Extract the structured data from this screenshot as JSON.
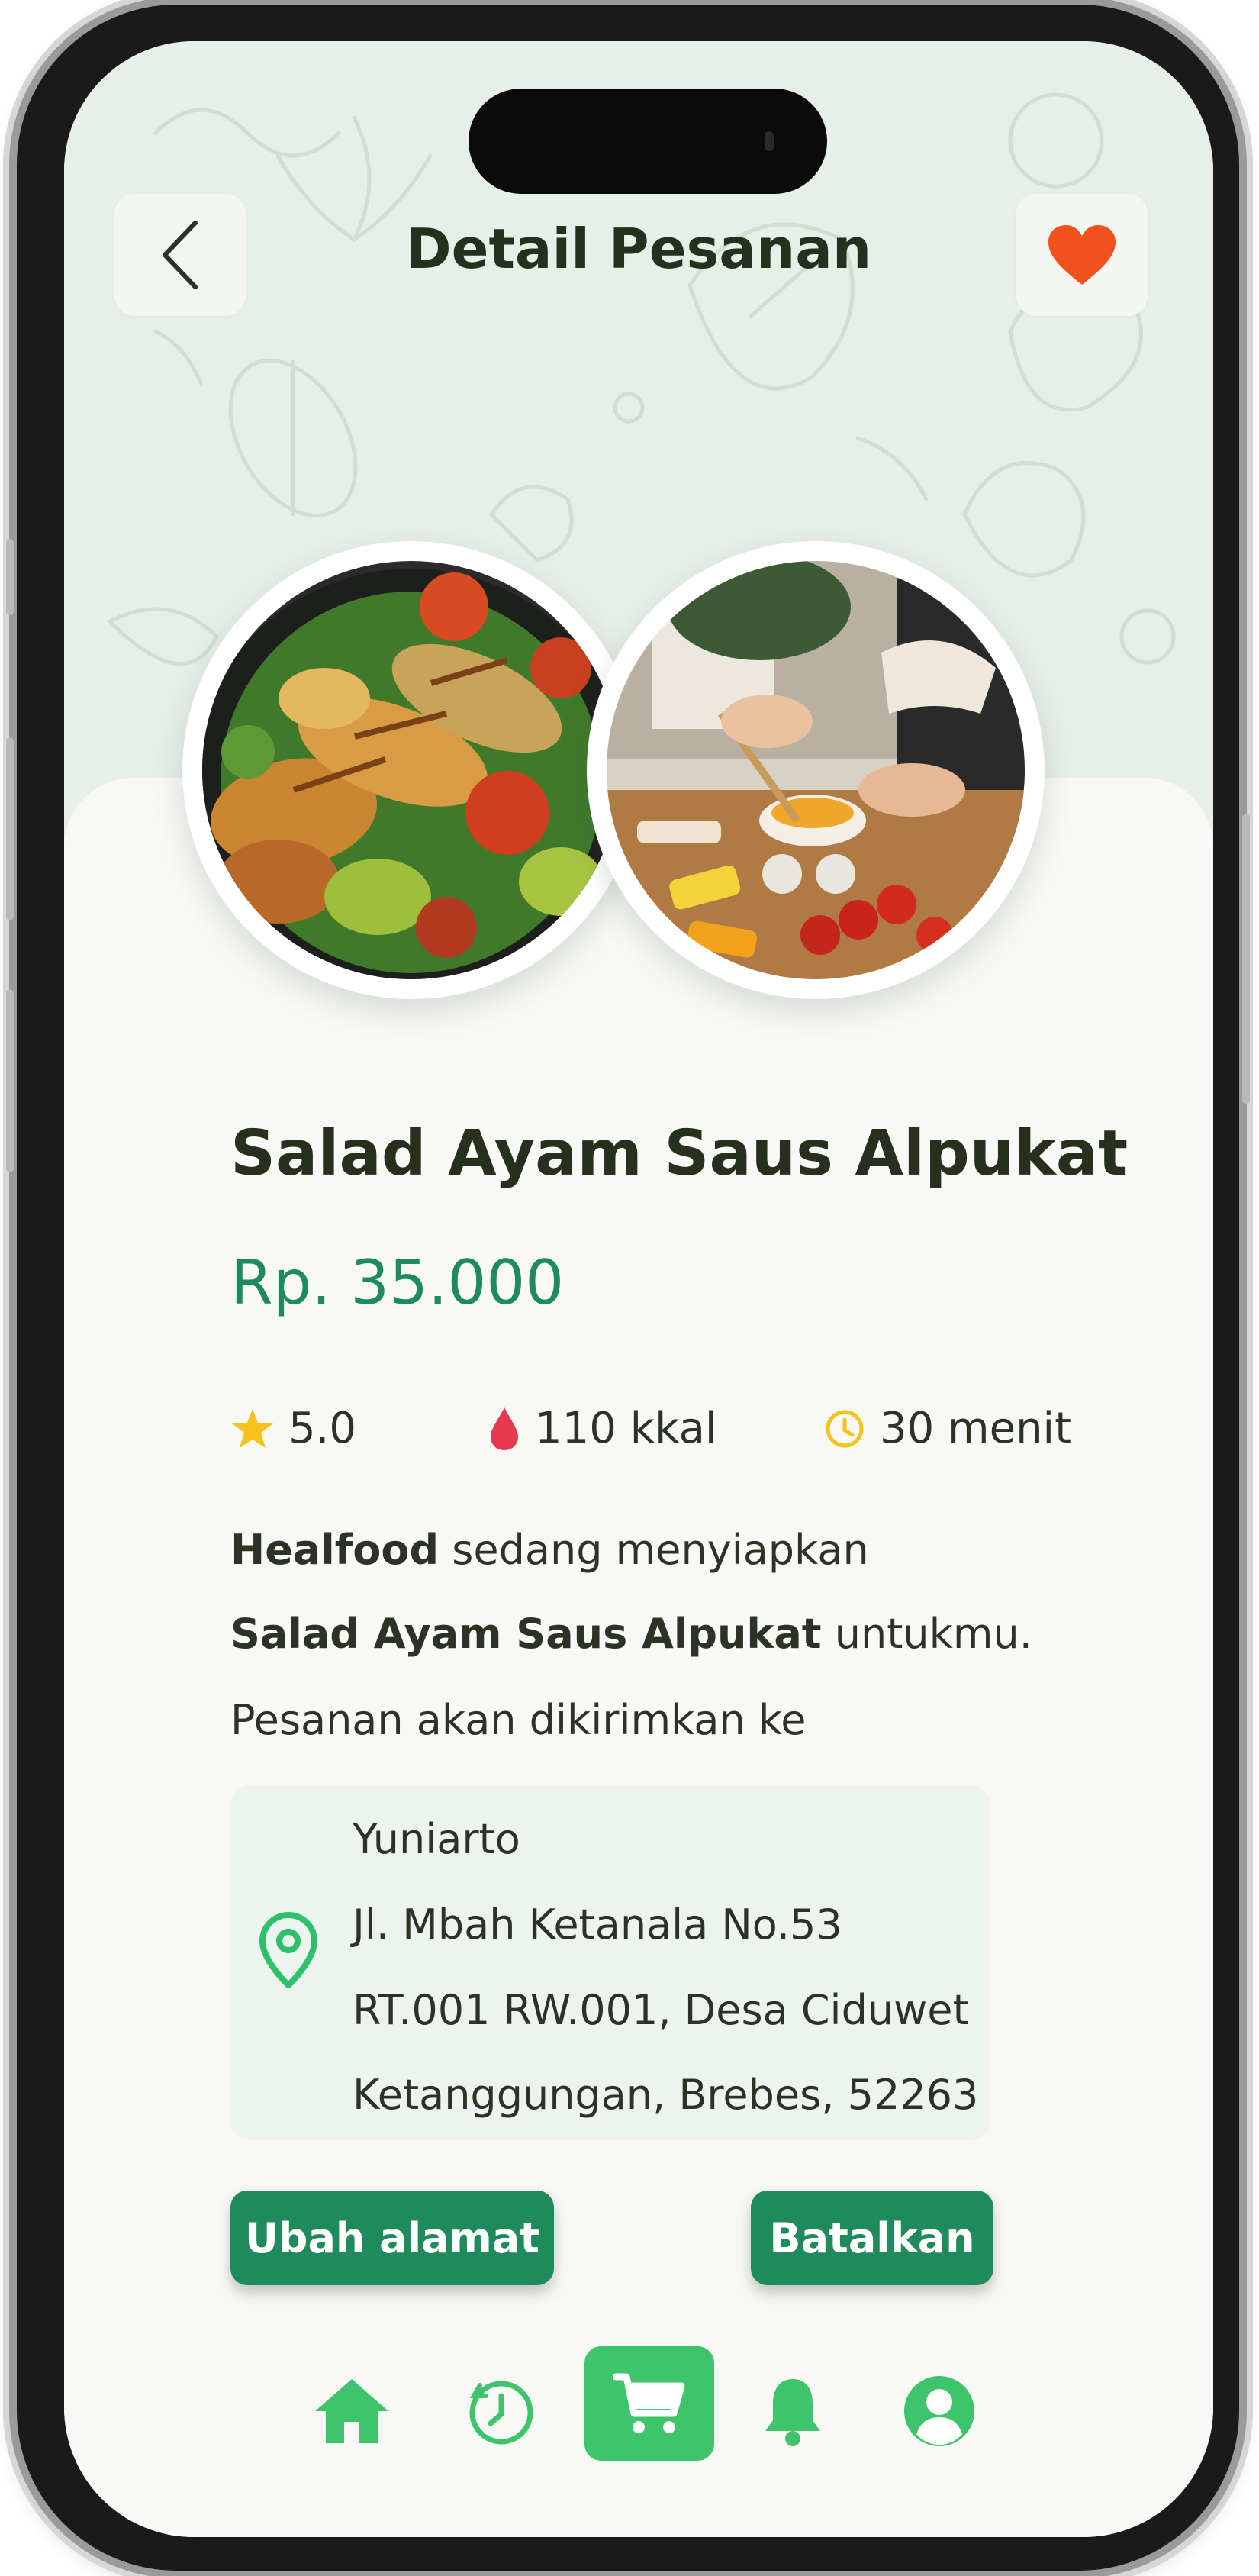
{
  "header": {
    "title": "Detail Pesanan",
    "back_icon": "chevron-left-icon",
    "favorite_icon": "heart-icon"
  },
  "product": {
    "name": "Salad Ayam Saus Alpukat",
    "price": "Rp. 35.000",
    "rating": "5.0",
    "calories": "110 kkal",
    "time": "30 menit"
  },
  "description": {
    "line1_bold": "Healfood",
    "line1_rest": " sedang menyiapkan",
    "line2_bold": "Salad Ayam Saus Alpukat",
    "line2_rest": " untukmu.",
    "line3": "Pesanan akan dikirimkan ke"
  },
  "address": {
    "name": "Yuniarto",
    "street": "Jl. Mbah Ketanala No.53",
    "area": "RT.001 RW.001, Desa Ciduwet",
    "city": "Ketanggungan, Brebes, 52263"
  },
  "actions": {
    "change_address": "Ubah alamat",
    "cancel": "Batalkan"
  },
  "nav": {
    "items": [
      "home-icon",
      "history-icon",
      "cart-icon",
      "bell-icon",
      "profile-icon"
    ],
    "active": "cart-icon"
  },
  "colors": {
    "primary": "#1f8a5c",
    "accent_green": "#3ec46a",
    "price": "#1e8a62",
    "heart": "#f2511d",
    "star": "#f6c21b",
    "calorie": "#e8384f",
    "header_bg": "#e6efe8"
  }
}
